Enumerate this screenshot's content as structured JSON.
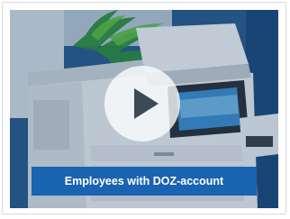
{
  "video": {
    "caption": "Employees with DOZ-account",
    "play_icon": "play-icon",
    "colors": {
      "frame": "#18467a",
      "caption_bg": "#1a63b0",
      "caption_text": "#ffffff"
    }
  }
}
